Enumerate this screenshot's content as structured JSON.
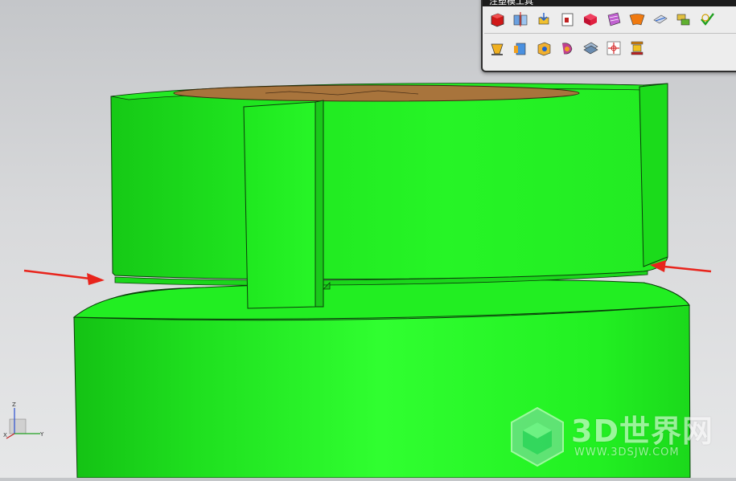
{
  "toolbar": {
    "title": "注塑模工具",
    "row1_icons": [
      "create-box-icon",
      "split-body-icon",
      "trim-solid-icon",
      "replace-face-icon",
      "extend-solid-icon",
      "reference-face-icon",
      "sheet-extend-icon",
      "split-face-icon",
      "merge-icon",
      "check-icon"
    ],
    "row2_icons": [
      "solid-patch-icon",
      "edge-patch-icon",
      "pocket-icon",
      "trim-region-icon",
      "parting-check-icon",
      "wcs-icon",
      "mold-base-icon"
    ]
  },
  "triad": {
    "z_label": "Z",
    "x_label": "X",
    "y_label": "Y"
  },
  "watermark": {
    "brand": "3D世界网",
    "url": "WWW.3DSJW.COM"
  },
  "colors": {
    "part_green": "#1ef51e",
    "arrow_red": "#e8241c",
    "cavity_brown": "#a8743c"
  }
}
